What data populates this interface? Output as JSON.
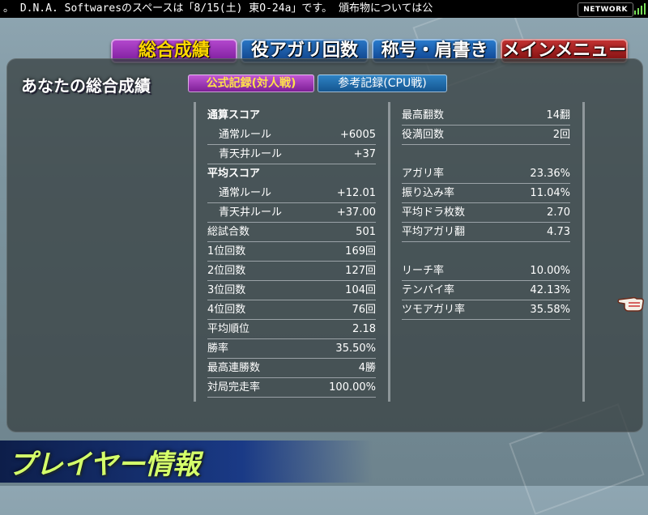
{
  "ticker": {
    "text": "。 D.N.A. Softwaresのスペースは「8/15(土) 東O-24a」です。 頒布物については公"
  },
  "network": {
    "label": "NETWORK"
  },
  "tabs": [
    {
      "label": "総合成績"
    },
    {
      "label": "役アガリ回数"
    },
    {
      "label": "称号・肩書き"
    },
    {
      "label": "メインメニュー"
    }
  ],
  "title": "あなたの総合成績",
  "record_buttons": {
    "official": "公式記録(対人戦)",
    "reference": "参考記録(CPU戦)"
  },
  "left_stats": {
    "total_score": {
      "heading": "通算スコア",
      "normal": {
        "label": "通常ルール",
        "value": "+6005"
      },
      "aotenjo": {
        "label": "青天井ルール",
        "value": "+37"
      }
    },
    "avg_score": {
      "heading": "平均スコア",
      "normal": {
        "label": "通常ルール",
        "value": "+12.01"
      },
      "aotenjo": {
        "label": "青天井ルール",
        "value": "+37.00"
      }
    },
    "rows": [
      {
        "label": "総試合数",
        "value": "501"
      },
      {
        "label": "1位回数",
        "value": "169回"
      },
      {
        "label": "2位回数",
        "value": "127回"
      },
      {
        "label": "3位回数",
        "value": "104回"
      },
      {
        "label": "4位回数",
        "value": "76回"
      },
      {
        "label": "平均順位",
        "value": "2.18"
      },
      {
        "label": "勝率",
        "value": "35.50%"
      },
      {
        "label": "最高連勝数",
        "value": "4勝"
      },
      {
        "label": "対局完走率",
        "value": "100.00%"
      }
    ]
  },
  "right_stats": {
    "group1": [
      {
        "label": "最高翻数",
        "value": "14翻"
      },
      {
        "label": "役満回数",
        "value": "2回"
      }
    ],
    "group2": [
      {
        "label": "アガリ率",
        "value": "23.36%"
      },
      {
        "label": "振り込み率",
        "value": "11.04%"
      },
      {
        "label": "平均ドラ枚数",
        "value": "2.70"
      },
      {
        "label": "平均アガリ翻",
        "value": "4.73"
      }
    ],
    "group3": [
      {
        "label": "リーチ率",
        "value": "10.00%"
      },
      {
        "label": "テンパイ率",
        "value": "42.13%"
      },
      {
        "label": "ツモアガリ率",
        "value": "35.58%"
      }
    ]
  },
  "bottom_banner": "プレイヤー情報"
}
